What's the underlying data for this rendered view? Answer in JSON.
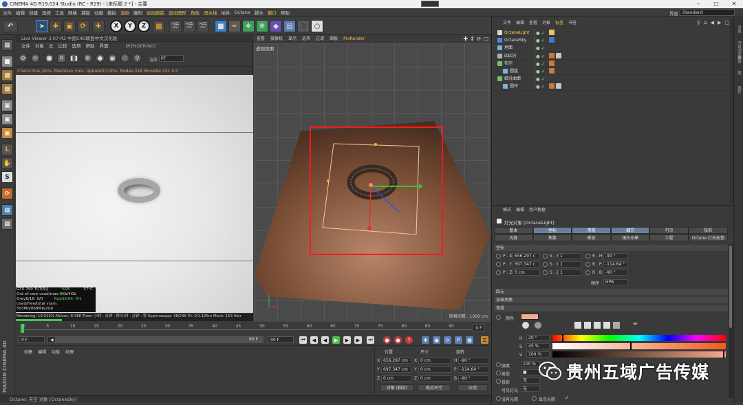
{
  "window": {
    "title": "CINEMA 4D R19.024 Studio (RC - R19) - [未标题 2 *] - 主要"
  },
  "menubar": {
    "items": [
      "文件",
      "编辑",
      "创建",
      "选择",
      "工具",
      "网格",
      "捕捉",
      "动画",
      "模拟",
      "渲染",
      "雕刻",
      "运动跟踪",
      "运动图形",
      "角色",
      "流水线",
      "插件",
      "Octane",
      "脚本",
      "窗口",
      "帮助"
    ],
    "highlighted": [
      "渲染",
      "运动跟踪",
      "运动图形",
      "角色",
      "流水线",
      "窗口"
    ],
    "layout_label": "界面",
    "layout_value": "Standard"
  },
  "toolbar": {
    "axes": [
      "X",
      "Y",
      "Z"
    ]
  },
  "live_viewer": {
    "title": "Live Viewer 3.07-R2 中国C4D联盟中文汉化版",
    "menu": [
      "文件",
      "对象",
      "云",
      "比较",
      "选项",
      "帮助",
      "界面"
    ],
    "state": "[RENDERING]",
    "kernel_label": "渲染",
    "kernel_value": "PT",
    "check_line": "Check:0ms./2ms. MeshGen:3ms. Update(C):0ms. Nodes:318 Movable:151  0 0",
    "stats": [
      {
        "k": "GTX 750 Ti[T(S)]",
        "v1": "%95",
        "v2": "37°C"
      },
      {
        "k": "Out-of-core used/max:0Kb/4Gb",
        "v1": "",
        "v2": ""
      },
      {
        "k": "Grey8/16: 0/0",
        "v1": "Rgb32/64: 0/1",
        "v2": ""
      },
      {
        "k": "Used/free/total vram: 593Mb/868Mb/2Gb",
        "v1": "",
        "v2": ""
      }
    ],
    "status_line": "Rendering: 19.512%  Ms/sec: 8.388  Time: 小时 : 分钟 : 秒/小时 : 分钟 : 秒  Spp/maxspp: 48/246  Tri: 0/1.105m  Mesh: 153  Hair",
    "progress": 0.195
  },
  "viewport": {
    "menu": [
      "查看",
      "摄像机",
      "显示",
      "选项",
      "过滤",
      "面板",
      "ProRender"
    ],
    "name": "透视视图",
    "grid_scale": "网格间距 : 1000 cm"
  },
  "object_manager": {
    "menu": [
      "文件",
      "编辑",
      "查看",
      "对象",
      "标签",
      "书签"
    ],
    "highlighted": [
      "标签"
    ],
    "objects": [
      {
        "name": "OctaneLight",
        "indent": 0,
        "icon": "light",
        "icon_color": "#d8d8d8",
        "is_light": true,
        "tags": [
          "#f0c060"
        ]
      },
      {
        "name": "OctaneSky",
        "indent": 0,
        "icon": "sky",
        "icon_color": "#4b8ad8",
        "is_light": false,
        "tags": [
          "#3a7bd5"
        ]
      },
      {
        "name": "地面",
        "indent": 0,
        "icon": "floor",
        "icon_color": "#7cb0e0",
        "is_light": false,
        "tags": []
      },
      {
        "name": "四四方",
        "indent": 0,
        "icon": "null",
        "icon_color": "#aab2c0",
        "is_light": false,
        "tags": [
          "#c77a3a",
          "#c8c8c8"
        ]
      },
      {
        "name": "布尔",
        "indent": 0,
        "icon": "boole",
        "icon_color": "#6fc06f",
        "is_light": false,
        "tags": [
          "#c77a3a"
        ]
      },
      {
        "name": "圆盘",
        "indent": 1,
        "icon": "disc",
        "icon_color": "#7cb0e0",
        "is_light": false,
        "tags": [
          "#c77a3a"
        ]
      },
      {
        "name": "细分曲面",
        "indent": 0,
        "icon": "subdiv",
        "icon_color": "#6fc06f",
        "is_light": false,
        "tags": []
      },
      {
        "name": "圆环",
        "indent": 1,
        "icon": "torus",
        "icon_color": "#7cb0e0",
        "is_light": false,
        "tags": [
          "#c77a3a",
          "#c8c8c8"
        ]
      }
    ]
  },
  "attribute_manager": {
    "menu": [
      "模式",
      "编辑",
      "用户数据"
    ],
    "object_name": "灯光对象 [OctaneLight]",
    "tabs_row1": [
      "基本",
      "坐标",
      "常规",
      "细节",
      "可见",
      "投影"
    ],
    "tabs_row2": [
      "光度",
      "焦散",
      "噪波",
      "镜头光晕",
      "工程",
      "Octane 灯光标签"
    ],
    "active_tabs": [
      "坐标",
      "常规",
      "细节"
    ],
    "section_coord": "坐标",
    "coords": [
      {
        "p": "P . X",
        "pv": "656.297 c",
        "s": "S . X",
        "sv": "1",
        "r": "R . H",
        "rv": "-90 °"
      },
      {
        "p": "P . Y",
        "pv": "697.347 c",
        "s": "S . Y",
        "sv": "1",
        "r": "R . P",
        "rv": "-114.64 °"
      },
      {
        "p": "P . Z",
        "pv": "0 cm",
        "s": "S . Z",
        "sv": "1",
        "r": "R . B",
        "rv": "-90 °"
      }
    ],
    "order_label": "顺序",
    "order_value": "HPB",
    "collapsed": [
      "四元",
      "冻结变换"
    ],
    "section_general": "常规",
    "color_label": "颜色",
    "color_value": "#f7ad8c",
    "h_label": "H",
    "h_value": "20 °",
    "s_label": "S",
    "s_value": "45 %",
    "v_label": "V",
    "v_value": "100 %",
    "intensity_label": "强度",
    "intensity_value": "100 %",
    "type_label": "类型",
    "shadow_label": "投影",
    "shadow_value": "无",
    "visible_label": "可见灯光",
    "visible_value": "无",
    "no_light_label": "没有光照",
    "show_light_label": "显示光照"
  },
  "timeline": {
    "ticks": [
      "0",
      "5",
      "10",
      "15",
      "20",
      "25",
      "30",
      "35",
      "40",
      "45",
      "50",
      "55",
      "60",
      "65",
      "70",
      "75",
      "80",
      "85",
      "90"
    ],
    "current_frame": "0 F"
  },
  "transport": {
    "start": "0 F",
    "cur": "0 F",
    "range_end": "90 F",
    "end": "90 F"
  },
  "material": {
    "menu": [
      "创建",
      "编辑",
      "功能",
      "纹理"
    ]
  },
  "coord_panel": {
    "headers": [
      "位置",
      "尺寸",
      "旋转"
    ],
    "rows": [
      {
        "a": "X",
        "av": "656.297 cm",
        "b": "X",
        "bv": "0 cm",
        "c": "H",
        "cv": "-90 °"
      },
      {
        "a": "Y",
        "av": "697.347 cm",
        "b": "Y",
        "bv": "0 cm",
        "c": "P",
        "cv": "-114.64 °"
      },
      {
        "a": "Z",
        "av": "0 cm",
        "b": "Z",
        "bv": "0 cm",
        "c": "B",
        "cv": "-90 °"
      }
    ],
    "mode": "对象 (相对)",
    "size_mode": "绝对尺寸",
    "apply": "应用"
  },
  "status": {
    "text": "Octane: 天空 对象 [OctaneSky]"
  },
  "right_tabs": [
    "对象",
    "内容浏览器",
    "构造",
    "层",
    "属性"
  ],
  "watermark": {
    "text": "贵州五域广告传媒"
  },
  "maxon": "MAXON CINEMA 4D"
}
